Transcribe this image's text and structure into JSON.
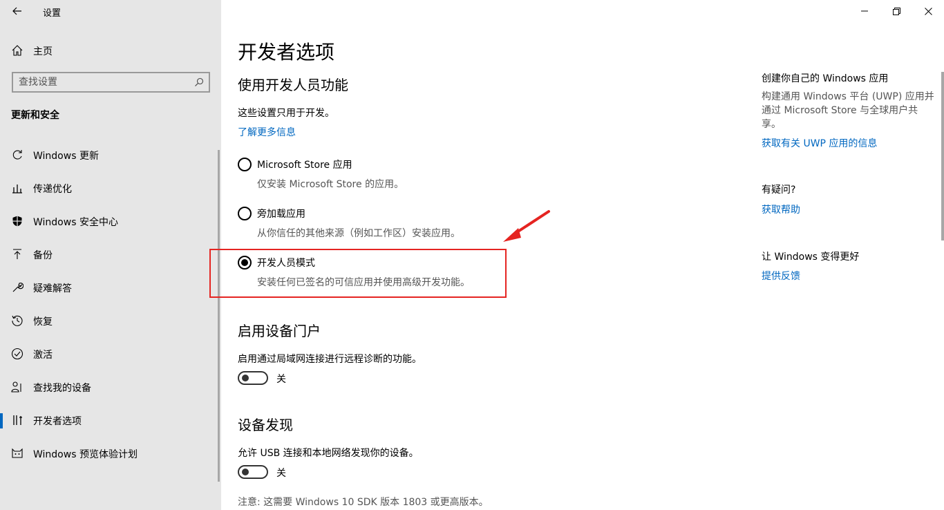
{
  "window": {
    "title": "设置"
  },
  "sidebar": {
    "home_label": "主页",
    "search_placeholder": "查找设置",
    "section_title": "更新和安全",
    "items": [
      {
        "label": "Windows 更新",
        "icon": "refresh-icon"
      },
      {
        "label": "传递优化",
        "icon": "delivery-optimization-icon"
      },
      {
        "label": "Windows 安全中心",
        "icon": "shield-icon"
      },
      {
        "label": "备份",
        "icon": "backup-arrow-icon"
      },
      {
        "label": "疑难解答",
        "icon": "wrench-icon"
      },
      {
        "label": "恢复",
        "icon": "history-icon"
      },
      {
        "label": "激活",
        "icon": "checkmark-circle-icon"
      },
      {
        "label": "查找我的设备",
        "icon": "person-pin-icon"
      },
      {
        "label": "开发者选项",
        "icon": "developer-tools-icon",
        "active": true
      },
      {
        "label": "Windows 预览体验计划",
        "icon": "insider-cat-icon"
      }
    ]
  },
  "main": {
    "page_title": "开发者选项",
    "dev_features": {
      "heading": "使用开发人员功能",
      "description": "这些设置只用于开发。",
      "learn_more": "了解更多信息",
      "options": [
        {
          "label": "Microsoft Store 应用",
          "desc": "仅安装 Microsoft Store 的应用。",
          "checked": false
        },
        {
          "label": "旁加载应用",
          "desc": "从你信任的其他来源（例如工作区）安装应用。",
          "checked": false
        },
        {
          "label": "开发人员模式",
          "desc": "安装任何已签名的可信应用并使用高级开发功能。",
          "checked": true
        }
      ]
    },
    "device_portal": {
      "heading": "启用设备门户",
      "description": "启用通过局域网连接进行远程诊断的功能。",
      "toggle_label": "关"
    },
    "device_discovery": {
      "heading": "设备发现",
      "description": "允许 USB 连接和本地网络发现你的设备。",
      "toggle_label": "关",
      "note": "注意: 这需要 Windows 10 SDK 版本 1803 或更高版本。"
    }
  },
  "right_panel": {
    "create_heading": "创建你自己的 Windows 应用",
    "create_text": "构建通用 Windows 平台 (UWP) 应用并通过 Microsoft Store 与全球用户共享。",
    "create_link": "获取有关 UWP 应用的信息",
    "question_heading": "有疑问?",
    "question_link": "获取帮助",
    "feedback_heading": "让 Windows 变得更好",
    "feedback_link": "提供反馈"
  },
  "colors": {
    "accent": "#0067c0",
    "highlight": "#e52421",
    "sidebar_bg": "#e6e6e6"
  }
}
